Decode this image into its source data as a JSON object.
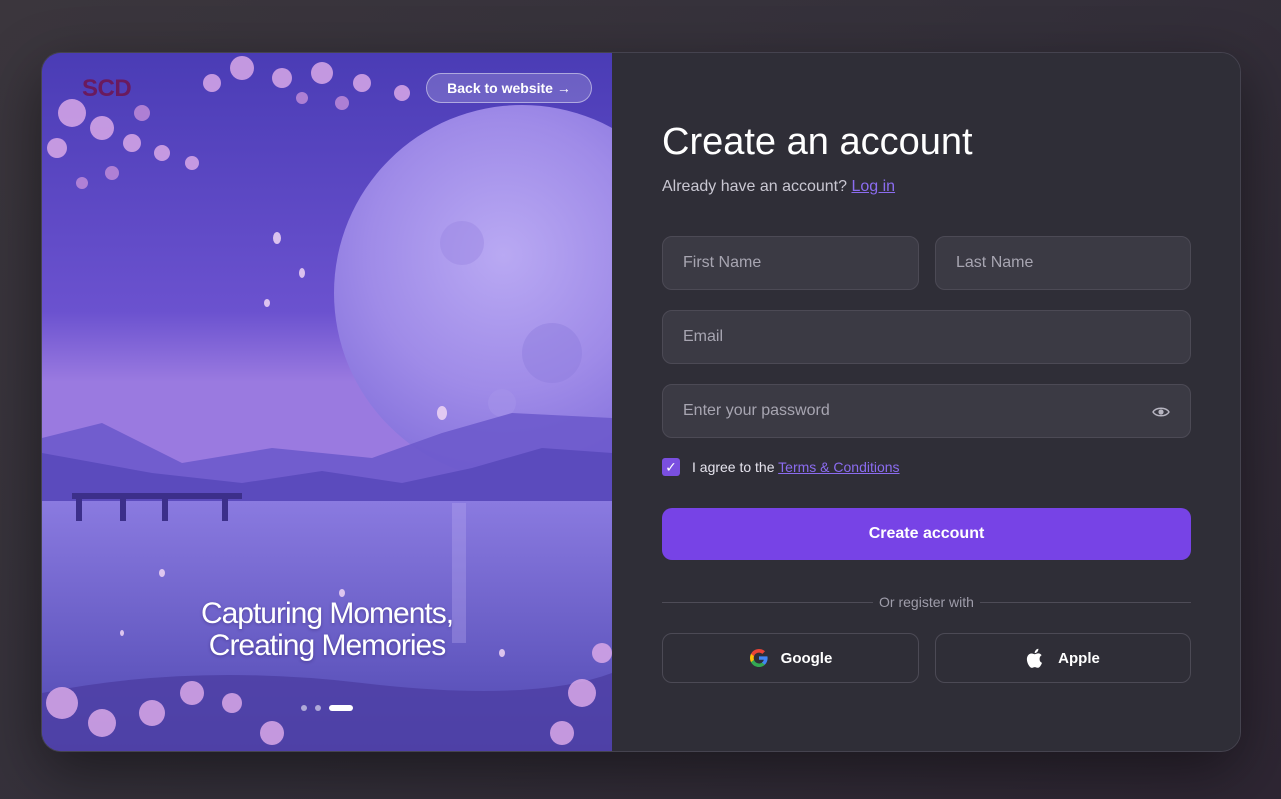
{
  "hero": {
    "logo": "SCD",
    "back_label": "Back to website →",
    "caption_line1": "Capturing Moments,",
    "caption_line2": "Creating Memories",
    "slides": 3,
    "active_slide": 3
  },
  "form": {
    "title": "Create an account",
    "subtitle": "Already have an account?",
    "login_link": "Log in",
    "first_name_placeholder": "First Name",
    "last_name_placeholder": "Last Name",
    "email_placeholder": "Email",
    "password_placeholder": "Enter your password",
    "agree_text": "I agree to the",
    "terms_link": "Terms & Conditions",
    "agree_checked": true,
    "checkmark": "✓",
    "submit_label": "Create account",
    "divider_text": "Or register with",
    "google_label": "Google",
    "apple_label": "Apple"
  },
  "colors": {
    "accent": "#7743e6",
    "link": "#8b6cf0",
    "panel": "#2f2e37",
    "field": "#3b3a44"
  },
  "icons": {
    "password_toggle": "eye-icon",
    "google": "google-icon",
    "apple": "apple-icon"
  }
}
